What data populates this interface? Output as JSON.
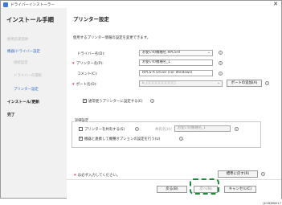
{
  "window": {
    "title": "ドライバーインストーラー",
    "close_label": "✕"
  },
  "sidebar": {
    "heading": "インストール手順",
    "items": [
      {
        "label": "使用許諾契約",
        "state": "done"
      },
      {
        "label": "機器/ドライバー設定",
        "state": "active"
      },
      {
        "label": "接続設定",
        "state": "dim"
      },
      {
        "label": "ドライバーの選択",
        "state": "dim"
      },
      {
        "label": "プリンター設定",
        "state": "active"
      },
      {
        "label": "インストール/更新",
        "state": "pending"
      },
      {
        "label": "完了",
        "state": "pending"
      }
    ]
  },
  "main": {
    "title": "プリンター設定",
    "description": "使用するプリンター情報の設定を変更できます。",
    "fields": {
      "driver_label": "ドライバー名(D):",
      "driver_value": "お使いの機種名 RPCS-R",
      "printer_name_label": "プリンター名(P):",
      "printer_name_value": "お使いの機種名_1",
      "comment_label": "コメント(C):",
      "comment_value": "RPCS-R Driver (For Windows)",
      "port_label": "ポート名(O):",
      "port_value": "E_□□□□□□□□□",
      "port_add_button": "ポートの追加(A)",
      "default_printer_label": "通常使うプリンターに設定する(E)",
      "default_printer_checked": true
    },
    "detail": {
      "group_title": "詳細設定",
      "share_label": "プリンターを共有する(S)",
      "share_checked": false,
      "share_name_label": "共有名(H):",
      "share_name_value": "お使いの機種名_1",
      "option_sync_label": "機器と連携して機種オプションの設定を行う(U)",
      "option_sync_checked": true
    },
    "footnote": "は必ず入力してください。",
    "restore_button": "標準に戻す(R)"
  },
  "footer": {
    "back_button": "戻る(B)",
    "next_button": "次へ(N)",
    "cancel_button": "キャンセル(C)"
  },
  "figure_code": "J103DM0017",
  "colors": {
    "accent": "#2f6fd0",
    "required": "#d0021b",
    "highlight": "#1e8a3a"
  },
  "icons": {
    "info": "info-icon",
    "checkbox": "checkbox-icon"
  }
}
